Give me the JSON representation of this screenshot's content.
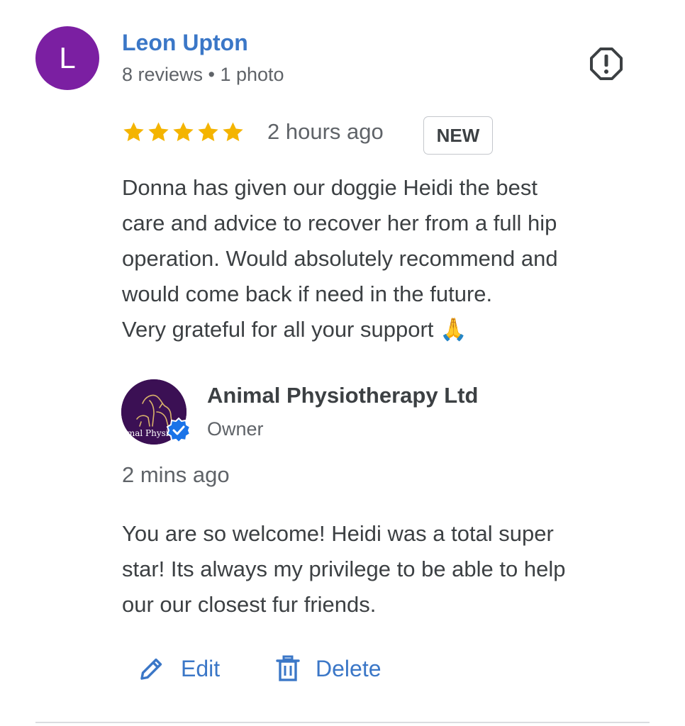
{
  "review": {
    "avatar_initial": "L",
    "reviewer_name": "Leon Upton",
    "reviewer_meta": "8 reviews • 1 photo",
    "rating": 5,
    "max_rating": 5,
    "time_ago": "2 hours ago",
    "badge": "NEW",
    "body_lines": [
      "Donna has given our doggie Heidi the best",
      "care and advice to recover her from a full hip",
      "operation. Would absolutely recommend and",
      "would come back if need in the future.",
      "Very grateful for all your support 🙏"
    ]
  },
  "reply": {
    "owner_name": "Animal Physiotherapy Ltd",
    "owner_role": "Owner",
    "logo_text": "imal Physio",
    "time_ago": "2 mins ago",
    "body_lines": [
      "You are so welcome! Heidi was a total super",
      "star! Its always my privilege to be able to help",
      "our our closest fur friends."
    ]
  },
  "actions": {
    "edit_label": "Edit",
    "delete_label": "Delete"
  },
  "icons": {
    "report": "report-icon",
    "star": "star-icon",
    "verified": "verified-badge-icon",
    "edit": "pencil-icon",
    "delete": "trash-icon"
  },
  "colors": {
    "link_blue": "#3b77c7",
    "avatar_purple": "#7b1fa2",
    "star_gold": "#f4b400",
    "verified_blue": "#1a73e8"
  }
}
